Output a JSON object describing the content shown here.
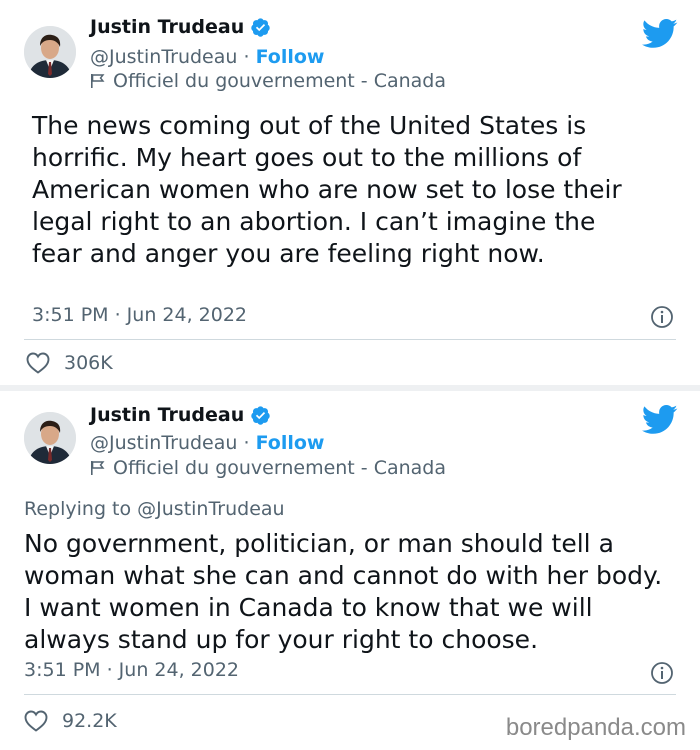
{
  "colors": {
    "accent": "#1d9bf0",
    "text": "#0f1419",
    "muted": "#536471",
    "separator": "#eef0f2"
  },
  "icons": {
    "verified": "verified-badge-icon",
    "bird": "twitter-bird-icon",
    "flag": "government-flag-icon",
    "info": "info-icon",
    "heart": "heart-icon"
  },
  "tweets": [
    {
      "name": "Justin Trudeau",
      "handle": "@JustinTrudeau",
      "separator": "·",
      "follow_label": "Follow",
      "gov_label": "Officiel du gouvernement - Canada",
      "body": "The news coming out of the United States is horrific. My heart goes out to the millions of American women who are now set to lose their legal right to an abortion. I can’t imagine the fear and anger you are feeling right now.",
      "timestamp": "3:51 PM · Jun 24, 2022",
      "likes": "306K"
    },
    {
      "name": "Justin Trudeau",
      "handle": "@JustinTrudeau",
      "separator": "·",
      "follow_label": "Follow",
      "gov_label": "Officiel du gouvernement - Canada",
      "replying_to": "Replying to @JustinTrudeau",
      "body": "No government, politician, or man should tell a woman what she can and cannot do with her body. I want women in Canada to know that we will always stand up for your right to choose.",
      "timestamp": "3:51 PM · Jun 24, 2022",
      "likes": "92.2K"
    }
  ],
  "watermark": "boredpanda.com"
}
